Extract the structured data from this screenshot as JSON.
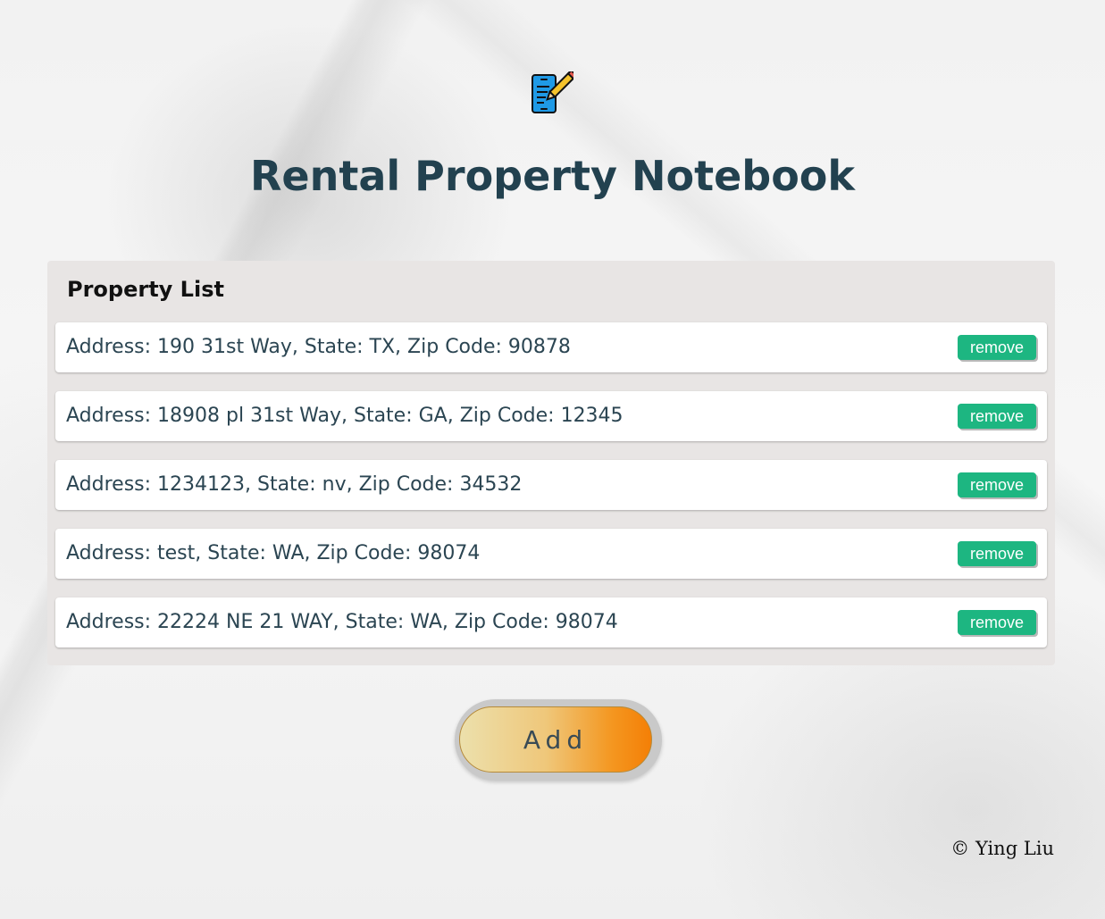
{
  "header": {
    "icon": "notepad-pencil-icon",
    "title": "Rental Property Notebook"
  },
  "property_list": {
    "heading": "Property List",
    "remove_label": "remove",
    "items": [
      {
        "text": "Address: 190 31st Way, State: TX, Zip Code: 90878"
      },
      {
        "text": "Address: 18908 pl 31st Way, State: GA, Zip Code: 12345"
      },
      {
        "text": "Address: 1234123, State: nv, Zip Code: 34532"
      },
      {
        "text": "Address: test, State: WA, Zip Code: 98074"
      },
      {
        "text": "Address: 22224 NE 21 WAY, State: WA, Zip Code: 98074"
      }
    ]
  },
  "actions": {
    "add_label": "Add"
  },
  "footer": {
    "copyright": "© Ying Liu"
  },
  "colors": {
    "title": "#22414f",
    "remove_button": "#1db681",
    "add_gradient_start": "#ece0ac",
    "add_gradient_end": "#f47f06",
    "panel_bg": "#e8e5e4"
  }
}
